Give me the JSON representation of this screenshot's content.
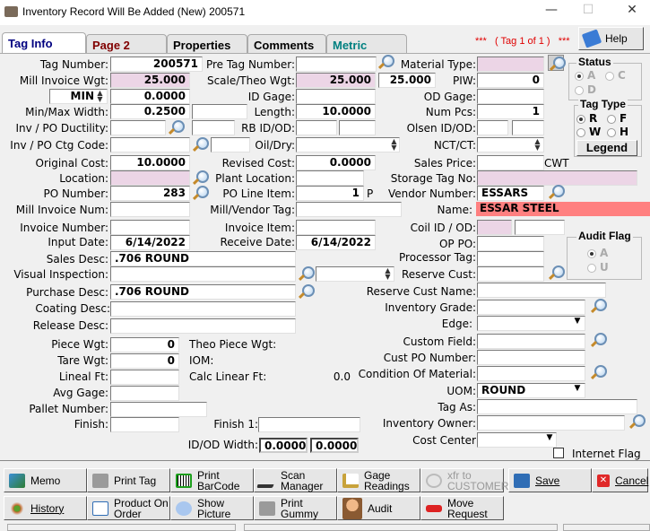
{
  "window": {
    "title": "Inventory Record Will Be Added  (New) 200571",
    "minimize": "—",
    "maximize": "☐",
    "close": "✕"
  },
  "tabs": [
    {
      "label": "Tag Info",
      "color": "#000080",
      "active": true
    },
    {
      "label": "Page 2",
      "color": "#800000"
    },
    {
      "label": "Properties",
      "color": "#000000"
    },
    {
      "label": "Comments",
      "color": "#000000"
    },
    {
      "label": "Metric",
      "color": "#008080"
    }
  ],
  "tag_counter": "***   ( Tag 1 of 1 )   ***",
  "help_label": "Help",
  "left": {
    "tag_number": {
      "label": "Tag Number:",
      "value": "200571"
    },
    "mill_invoice_wgt": {
      "label": "Mill Invoice Wgt:",
      "value": "25.000"
    },
    "unit_select": {
      "value": "MIN"
    },
    "unit_value": {
      "value": "0.0000"
    },
    "min_max_width": {
      "label": "Min/Max Width:",
      "value": "0.2500",
      "value2": ""
    },
    "inv_po_ductility": {
      "label": "Inv / PO Ductility:",
      "value": "",
      "value2": ""
    },
    "inv_po_ctg_code": {
      "label": "Inv / PO Ctg Code:",
      "value": "",
      "value2": ""
    },
    "original_cost": {
      "label": "Original Cost:",
      "value": "10.0000"
    },
    "location": {
      "label": "Location:",
      "value": ""
    },
    "po_number": {
      "label": "PO Number:",
      "value": "283"
    },
    "mill_invoice_num": {
      "label": "Mill Invoice Num:",
      "value": ""
    },
    "invoice_number": {
      "label": "Invoice Number:",
      "value": ""
    },
    "input_date": {
      "label": "Input Date:",
      "value": "6/14/2022"
    },
    "sales_desc": {
      "label": "Sales Desc:",
      "value": ".706 ROUND"
    },
    "visual_inspection": {
      "label": "Visual Inspection:",
      "value": ""
    },
    "purchase_desc": {
      "label": "Purchase Desc:",
      "value": ".706 ROUND"
    },
    "coating_desc": {
      "label": "Coating Desc:",
      "value": ""
    },
    "release_desc": {
      "label": "Release Desc:",
      "value": ""
    },
    "piece_wgt": {
      "label": "Piece Wgt:",
      "value": "0"
    },
    "tare_wgt": {
      "label": "Tare Wgt:",
      "value": "0"
    },
    "lineal_ft": {
      "label": "Lineal Ft:",
      "value": ""
    },
    "avg_gage": {
      "label": "Avg Gage:",
      "value": ""
    },
    "pallet_number": {
      "label": "Pallet Number:",
      "value": ""
    },
    "finish": {
      "label": "Finish:",
      "value": ""
    }
  },
  "middle": {
    "pre_tag_number": {
      "label": "Pre Tag Number:",
      "value": ""
    },
    "scale_theo_wgt": {
      "label": "Scale/Theo Wgt:",
      "value": "25.000",
      "value2": "25.000"
    },
    "id_gage": {
      "label": "ID Gage:",
      "value": ""
    },
    "length": {
      "label": "Length:",
      "value": "10.0000"
    },
    "rb_id_od": {
      "label": "RB ID/OD:",
      "value": "",
      "value2": ""
    },
    "oil_dry": {
      "label": "Oil/Dry:",
      "value": ""
    },
    "revised_cost": {
      "label": "Revised Cost:",
      "value": "0.0000"
    },
    "plant_location": {
      "label": "Plant Location:",
      "value": ""
    },
    "po_line_item": {
      "label": "PO Line Item:",
      "value": "1",
      "suffix": "P"
    },
    "mill_vendor_tag": {
      "label": "Mill/Vendor Tag:",
      "value": ""
    },
    "invoice_item": {
      "label": "Invoice Item:",
      "value": ""
    },
    "receive_date": {
      "label": "Receive Date:",
      "value": "6/14/2022"
    },
    "visual_select": {
      "value": ""
    },
    "theo_piece_wgt": {
      "label": "Theo Piece Wgt:",
      "value": ""
    },
    "iom": {
      "label": "IOM:",
      "value": ""
    },
    "calc_linear_ft": {
      "label": "Calc Linear Ft:",
      "value": "0.0"
    },
    "finish_1": {
      "label": "Finish 1:",
      "value": ""
    },
    "id_od_width": {
      "label": "ID/OD Width:",
      "value": "0.0000",
      "value2": "0.0000"
    }
  },
  "right": {
    "material_type": {
      "label": "Material Type:",
      "value": ""
    },
    "piw": {
      "label": "PIW:",
      "value": "0"
    },
    "od_gage": {
      "label": "OD Gage:",
      "value": ""
    },
    "num_pcs": {
      "label": "Num Pcs:",
      "value": "1"
    },
    "olsen_id_od": {
      "label": "Olsen ID/OD:",
      "value": "",
      "value2": ""
    },
    "nct_ct": {
      "label": "NCT/CT:",
      "value": ""
    },
    "sales_price": {
      "label": "Sales Price:",
      "value": "",
      "unit": "CWT"
    },
    "storage_tag_no": {
      "label": "Storage Tag No:",
      "value": ""
    },
    "vendor_number": {
      "label": "Vendor Number:",
      "value": "ESSARS"
    },
    "name": {
      "label": "Name:",
      "value": "ESSAR STEEL"
    },
    "coil_id_od": {
      "label": "Coil ID / OD:",
      "value": "",
      "value2": ""
    },
    "op_po": {
      "label": "OP PO:",
      "value": ""
    },
    "processor_tag": {
      "label": "Processor Tag:",
      "value": ""
    },
    "reserve_cust": {
      "label": "Reserve Cust:",
      "value": "",
      "value2": ""
    },
    "reserve_cust_name": {
      "label": "Reserve Cust Name:",
      "value": ""
    },
    "inventory_grade": {
      "label": "Inventory Grade:",
      "value": ""
    },
    "edge": {
      "label": "Edge:",
      "value": ""
    },
    "custom_field": {
      "label": "Custom Field:",
      "value": ""
    },
    "cust_po_number": {
      "label": "Cust PO Number:",
      "value": ""
    },
    "condition_of_material": {
      "label": "Condition Of Material:",
      "value": ""
    },
    "uom": {
      "label": "UOM:",
      "value": "ROUND"
    },
    "tag_as": {
      "label": "Tag As:",
      "value": ""
    },
    "inventory_owner": {
      "label": "Inventory Owner:",
      "value": ""
    },
    "cost_center": {
      "label": "Cost Center",
      "value": ""
    },
    "internet_flag": {
      "label": "Internet Flag",
      "checked": false
    }
  },
  "status_group": {
    "title": "Status",
    "options": [
      "A",
      "C",
      "D"
    ],
    "selected": "A"
  },
  "tag_type_group": {
    "title": "Tag Type",
    "options": [
      "R",
      "F",
      "W",
      "H"
    ],
    "selected": "R",
    "legend_label": "Legend"
  },
  "audit_flag_group": {
    "title": "Audit Flag",
    "options": [
      "A",
      "U"
    ],
    "selected": "A"
  },
  "buttons": {
    "memo": "Memo",
    "print_tag": "Print Tag",
    "print_barcode": "Print\nBarCode",
    "scan_manager": "Scan\nManager",
    "gage_readings": "Gage\nReadings",
    "xfr_to_customer": "xfr to\nCUSTOMER",
    "save": "Save",
    "cancel": "Cancel",
    "history": "History",
    "product_on_order": "Product On\nOrder",
    "show_picture": "Show\nPicture",
    "print_gummy": "Print\nGummy",
    "audit": "Audit",
    "move_request": "Move\nRequest"
  }
}
